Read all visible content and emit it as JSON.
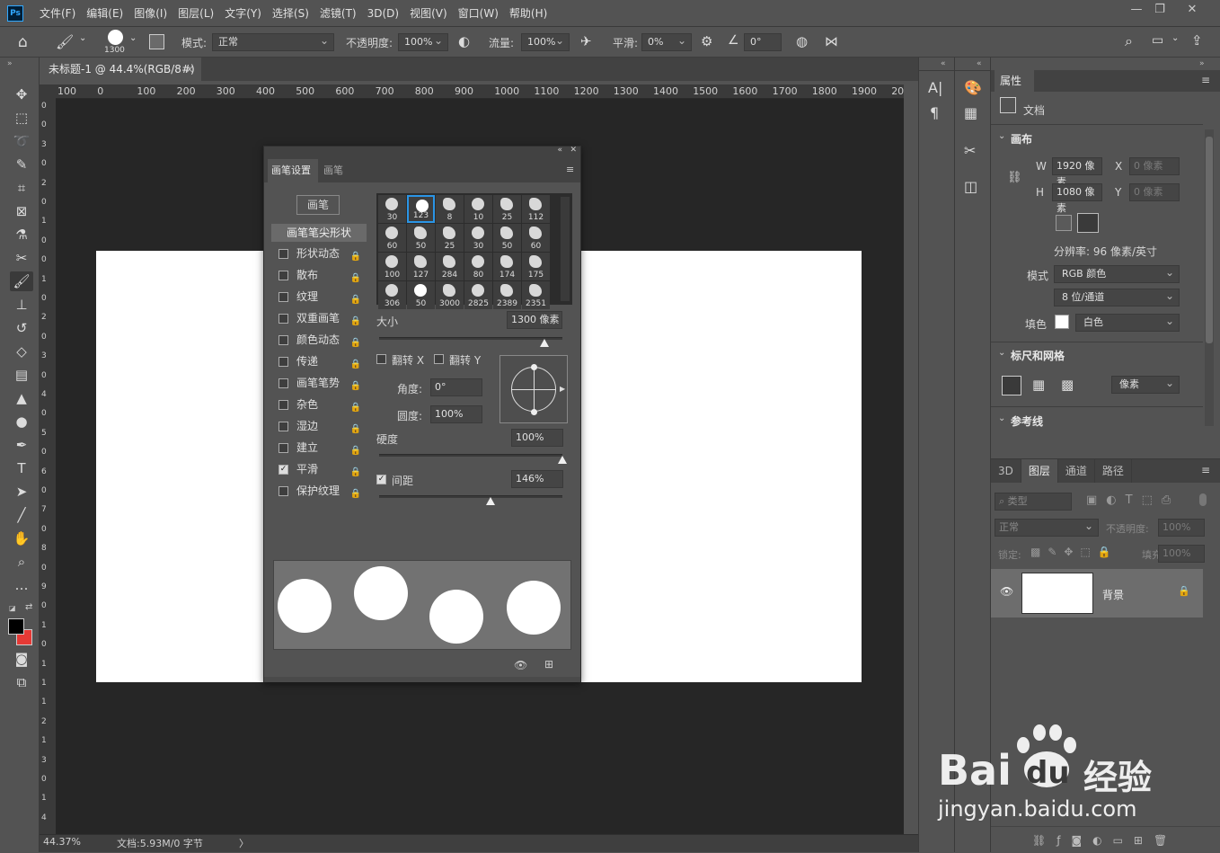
{
  "app": {
    "logo": "Ps"
  },
  "menu": [
    "文件(F)",
    "编辑(E)",
    "图像(I)",
    "图层(L)",
    "文字(Y)",
    "选择(S)",
    "滤镜(T)",
    "3D(D)",
    "视图(V)",
    "窗口(W)",
    "帮助(H)"
  ],
  "window_controls": {
    "minimize": "—",
    "restore": "❐",
    "close": "✕"
  },
  "options": {
    "brush_size": "1300",
    "mode_label": "模式:",
    "mode_value": "正常",
    "opacity_label": "不透明度:",
    "opacity_value": "100%",
    "flow_label": "流量:",
    "flow_value": "100%",
    "smooth_label": "平滑:",
    "smooth_value": "0%",
    "angle_value": "0°"
  },
  "document_tab": {
    "title": "未标题-1 @ 44.4%(RGB/8#)",
    "close": "×"
  },
  "ruler_top": [
    "100",
    "0",
    "100",
    "200",
    "300",
    "400",
    "500",
    "600",
    "700",
    "800",
    "900",
    "1000",
    "1100",
    "1200",
    "1300",
    "1400",
    "1500",
    "1600",
    "1700",
    "1800",
    "1900",
    "20"
  ],
  "ruler_left": [
    "0",
    "0",
    "3",
    "0",
    "2",
    "0",
    "1",
    "0",
    "0",
    "1",
    "0",
    "2",
    "0",
    "3",
    "0",
    "4",
    "0",
    "5",
    "0",
    "6",
    "0",
    "7",
    "0",
    "8",
    "0",
    "9",
    "0",
    "1",
    "0",
    "1",
    "1",
    "1",
    "2",
    "1",
    "3",
    "0",
    "1",
    "4"
  ],
  "status": {
    "zoom": "44.37%",
    "doc_info": "文档:5.93M/0 字节",
    "arrow": "〉"
  },
  "brush_panel": {
    "tabs": [
      "画笔设置",
      "画笔"
    ],
    "brush_button": "画笔",
    "tip_shape": "画笔笔尖形状",
    "items": [
      {
        "label": "形状动态",
        "checked": false
      },
      {
        "label": "散布",
        "checked": false
      },
      {
        "label": "纹理",
        "checked": false
      },
      {
        "label": "双重画笔",
        "checked": false
      },
      {
        "label": "颜色动态",
        "checked": false
      },
      {
        "label": "传递",
        "checked": false
      },
      {
        "label": "画笔笔势",
        "checked": false
      },
      {
        "label": "杂色",
        "checked": false
      },
      {
        "label": "湿边",
        "checked": false
      },
      {
        "label": "建立",
        "checked": false
      },
      {
        "label": "平滑",
        "checked": true
      },
      {
        "label": "保护纹理",
        "checked": false
      }
    ],
    "brush_sizes": [
      "30",
      "123",
      "8",
      "10",
      "25",
      "112",
      "60",
      "50",
      "25",
      "30",
      "50",
      "60",
      "100",
      "127",
      "284",
      "80",
      "174",
      "175",
      "306",
      "50",
      "3000",
      "2825",
      "2389",
      "2351"
    ],
    "size_label": "大小",
    "size_value": "1300 像素",
    "flip_x": "翻转 X",
    "flip_y": "翻转 Y",
    "angle_label": "角度:",
    "angle_value": "0°",
    "roundness_label": "圆度:",
    "roundness_value": "100%",
    "hardness_label": "硬度",
    "hardness_value": "100%",
    "spacing_label": "间距",
    "spacing_value": "146%",
    "size_level": 0.9,
    "hardness_level": 1.0,
    "spacing_level": 0.61
  },
  "properties": {
    "tab": "属性",
    "doc_label": "文档",
    "canvas_title": "画布",
    "w_label": "W",
    "w_value": "1920 像素",
    "h_label": "H",
    "h_value": "1080 像素",
    "x_label": "X",
    "x_value": "0 像素",
    "y_label": "Y",
    "y_value": "0 像素",
    "resolution": "分辨率: 96 像素/英寸",
    "mode_label": "模式",
    "mode_value": "RGB 颜色",
    "depth_value": "8 位/通道",
    "fill_label": "填色",
    "fill_value": "白色",
    "rulers_title": "标尺和网格",
    "units_value": "像素",
    "guides_title": "参考线"
  },
  "layers": {
    "tabs": [
      "3D",
      "图层",
      "通道",
      "路径"
    ],
    "filter_placeholder": "类型",
    "blend": "正常",
    "opacity_label": "不透明度:",
    "opacity_value": "100%",
    "lock_label": "锁定:",
    "fill_label": "填充:",
    "fill_value": "100%",
    "layer_name": "背景"
  },
  "watermark": {
    "brand": "Bai",
    "brand2": "du",
    "cn": "经验",
    "url": "jingyan.baidu.com"
  }
}
